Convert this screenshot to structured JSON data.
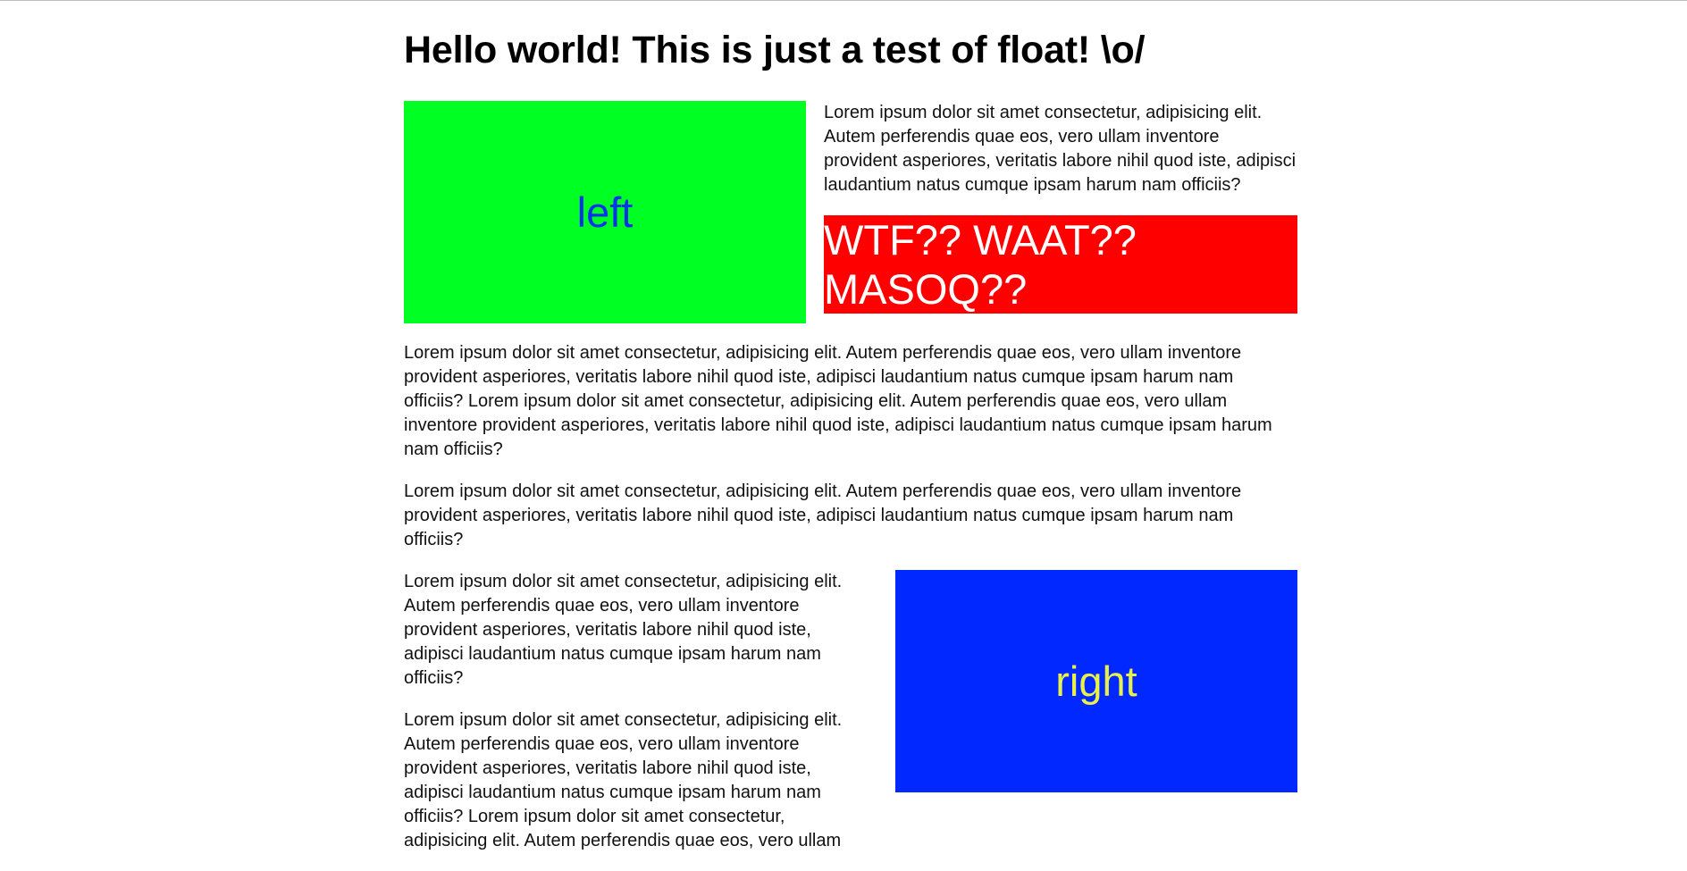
{
  "heading": "Hello world! This is just a test of float! \\o/",
  "colors": {
    "left_box_bg": "#00ff22",
    "left_box_text": "#0033ee",
    "wtf_box_bg": "#ff0000",
    "wtf_box_text": "#ffffff",
    "right_box_bg": "#0028ff",
    "right_box_text": "#e8f04a"
  },
  "boxes": {
    "left": "left",
    "wtf": "WTF?? WAAT?? MASOQ??",
    "right": "right"
  },
  "paragraphs": {
    "p1": "Lorem ipsum dolor sit amet consectetur, adipisicing elit. Autem perferendis quae eos, vero ullam inventore provident asperiores, veritatis labore nihil quod iste, adipisci laudantium natus cumque ipsam harum nam officiis?",
    "p2": "Lorem ipsum dolor sit amet consectetur, adipisicing elit. Autem perferendis quae eos, vero ullam inventore provident asperiores, veritatis labore nihil quod iste, adipisci laudantium natus cumque ipsam harum nam officiis? Lorem ipsum dolor sit amet consectetur, adipisicing elit. Autem perferendis quae eos, vero ullam inventore provident asperiores, veritatis labore nihil quod iste, adipisci laudantium natus cumque ipsam harum nam officiis?",
    "p3": "Lorem ipsum dolor sit amet consectetur, adipisicing elit. Autem perferendis quae eos, vero ullam inventore provident asperiores, veritatis labore nihil quod iste, adipisci laudantium natus cumque ipsam harum nam officiis?",
    "p4": "Lorem ipsum dolor sit amet consectetur, adipisicing elit. Autem perferendis quae eos, vero ullam inventore provident asperiores, veritatis labore nihil quod iste, adipisci laudantium natus cumque ipsam harum nam officiis?",
    "p5": "Lorem ipsum dolor sit amet consectetur, adipisicing elit. Autem perferendis quae eos, vero ullam inventore provident asperiores, veritatis labore nihil quod iste, adipisci laudantium natus cumque ipsam harum nam officiis? Lorem ipsum dolor sit amet consectetur, adipisicing elit. Autem perferendis quae eos, vero ullam"
  }
}
